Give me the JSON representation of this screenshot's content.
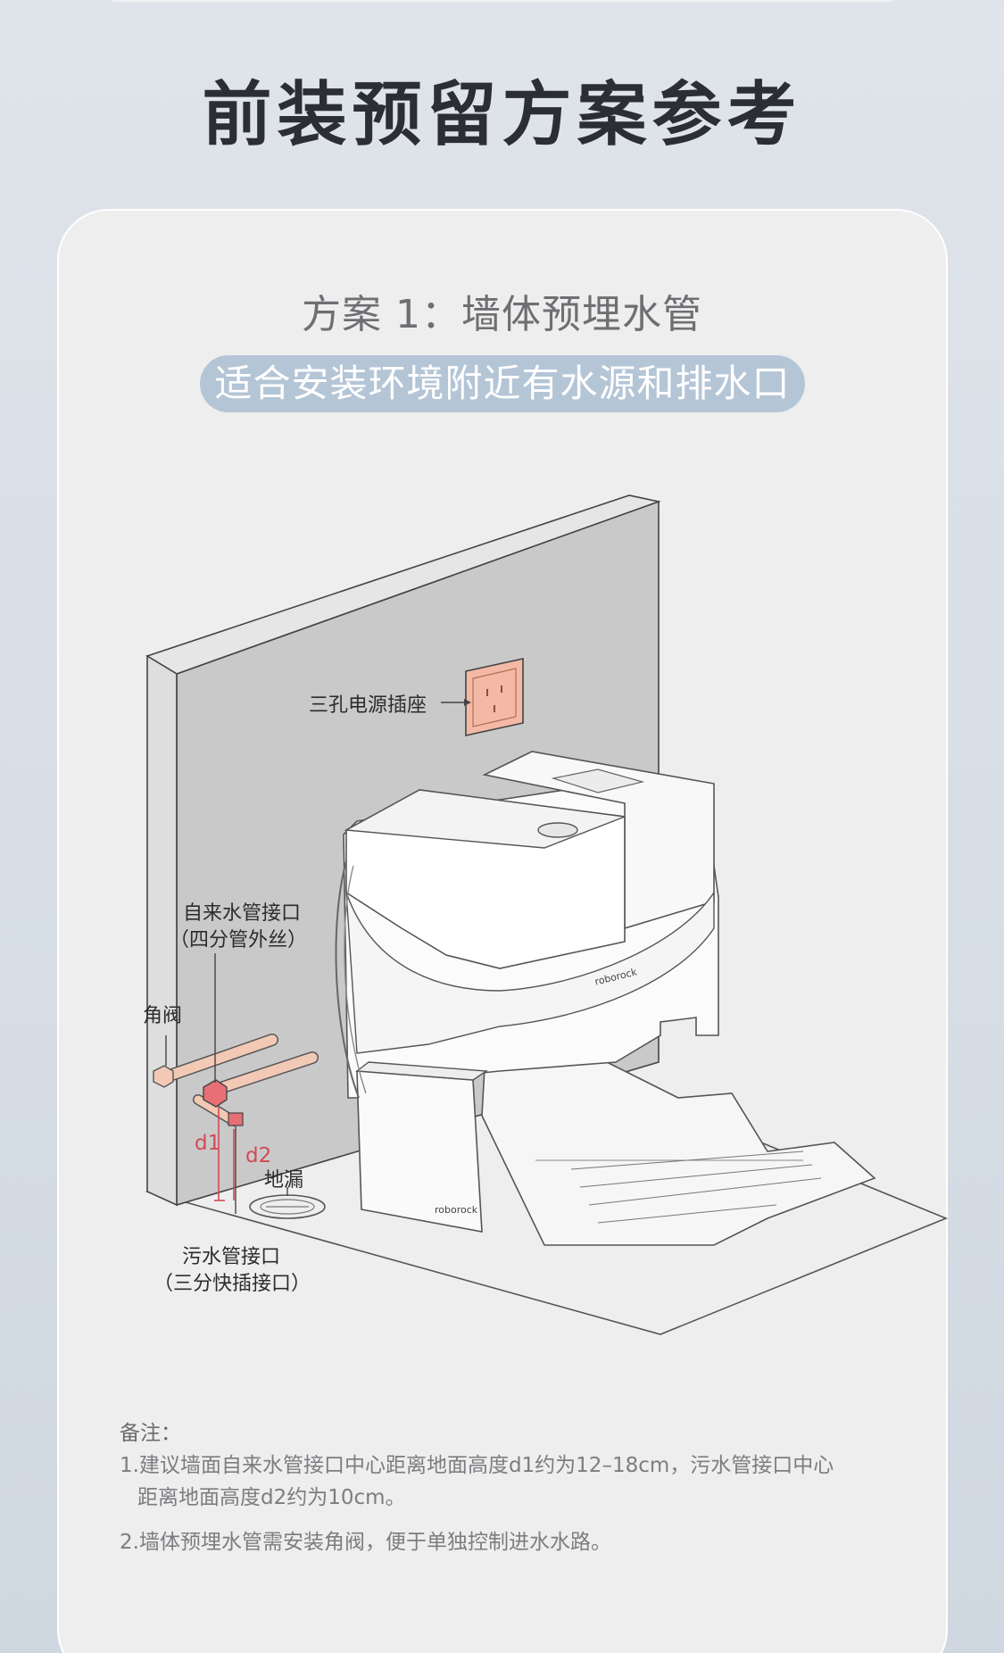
{
  "page": {
    "title": "前装预留方案参考"
  },
  "plan": {
    "title": "方案 1：墙体预埋水管",
    "subtitle": "适合安装环境附近有水源和排水口"
  },
  "labels": {
    "socket": "三孔电源插座",
    "inlet_line1": "自来水管接口",
    "inlet_line2": "（四分管外丝）",
    "valve": "角阀",
    "d1": "d1",
    "d2": "d2",
    "floor_drain": "地漏",
    "drain_line1": "污水管接口",
    "drain_line2": "（三分快插接口）",
    "brand_top": "roborock",
    "brand_front": "roborock"
  },
  "notes": {
    "title": "备注：",
    "item1_line1": "1.建议墙面自来水管接口中心距离地面高度d1约为12–18cm，污水管接口中心",
    "item1_line2": "距离地面高度d2约为10cm。",
    "item2": "2.墙体预埋水管需安装角阀，便于单独控制进水水路。"
  },
  "colors": {
    "title": "#2b2e33",
    "pill_bg": "#b4c5d6",
    "accent_red": "#d24a56",
    "pipe": "#f2c9b4",
    "socket": "#f3b9a4"
  }
}
